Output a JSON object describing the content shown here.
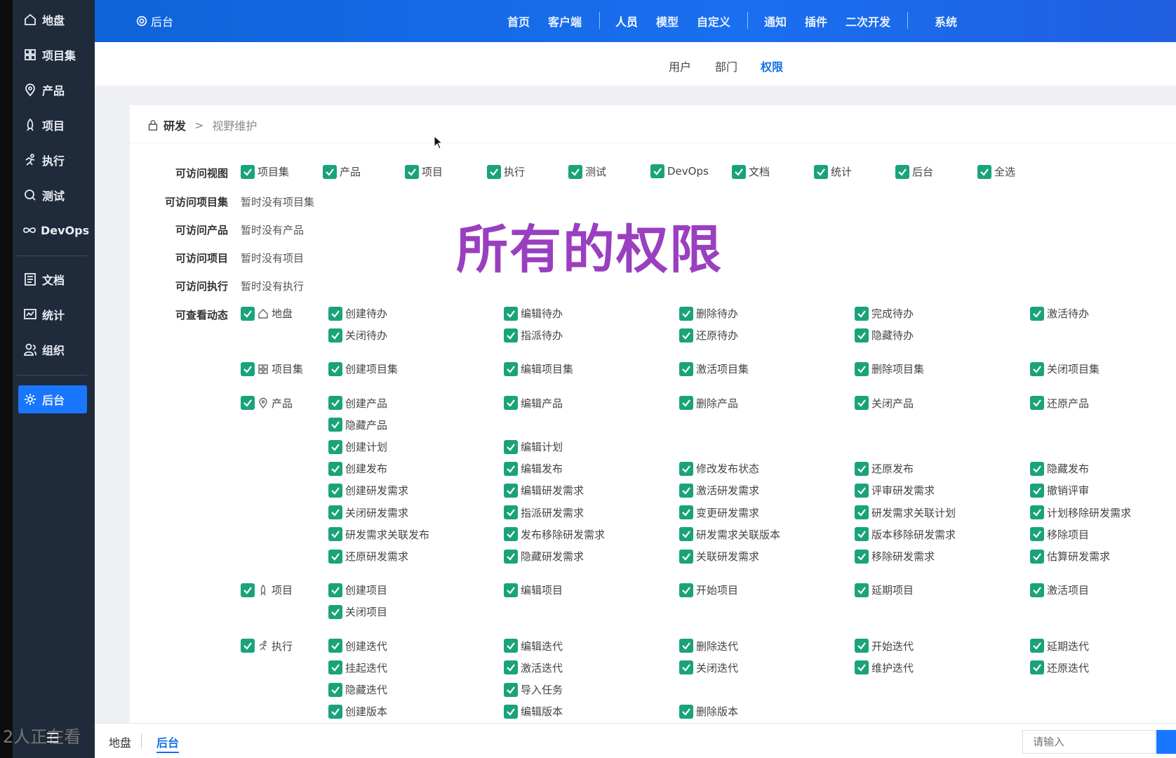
{
  "colors": {
    "sidebar_bg": "#1f2a3a",
    "header_blue": "#1a6ff0",
    "accent": "#1976ff",
    "check_green": "#1aa37a",
    "overlay_purple": "#9a3fbf"
  },
  "sidebar": {
    "items": [
      {
        "label": "地盘",
        "icon": "home-icon"
      },
      {
        "label": "项目集",
        "icon": "grid-icon"
      },
      {
        "label": "产品",
        "icon": "map-pin-icon"
      },
      {
        "label": "项目",
        "icon": "rocket-icon"
      },
      {
        "label": "执行",
        "icon": "runner-icon"
      },
      {
        "label": "测试",
        "icon": "magnifier-icon"
      },
      {
        "label": "DevOps",
        "icon": "infinity-icon"
      },
      {
        "label": "文档",
        "icon": "document-icon"
      },
      {
        "label": "统计",
        "icon": "chart-icon"
      },
      {
        "label": "组织",
        "icon": "people-icon"
      },
      {
        "label": "后台",
        "icon": "gear-icon",
        "active": true
      }
    ]
  },
  "header": {
    "brand": "后台",
    "nav": [
      "首页",
      "客户端",
      "人员",
      "模型",
      "自定义",
      "通知",
      "插件",
      "二次开发",
      "系统"
    ],
    "current": "人员"
  },
  "subnav": {
    "tabs": [
      "用户",
      "部门",
      "权限"
    ],
    "active": "权限"
  },
  "breadcrumb": {
    "root": "研发",
    "separator": ">",
    "current": "视野维护"
  },
  "overlay_text": "所有的权限",
  "form": {
    "views_label": "可访问视图",
    "views": [
      "项目集",
      "产品",
      "项目",
      "执行",
      "测试",
      "DevOps",
      "文档",
      "统计",
      "后台",
      "全选"
    ],
    "programs_label": "可访问项目集",
    "programs_value": "暂时没有项目集",
    "products_label": "可访问产品",
    "products_value": "暂时没有产品",
    "projects_label": "可访问项目",
    "projects_value": "暂时没有项目",
    "executions_label": "可访问执行",
    "executions_value": "暂时没有执行",
    "actions_label": "可查看动态",
    "groups": [
      {
        "module": "地盘",
        "icon": "home-icon",
        "rows": [
          [
            "创建待办",
            "编辑待办",
            "删除待办",
            "完成待办",
            "激活待办"
          ],
          [
            "关闭待办",
            "指派待办",
            "还原待办",
            "隐藏待办"
          ]
        ]
      },
      {
        "module": "项目集",
        "icon": "grid-icon",
        "rows": [
          [
            "创建项目集",
            "编辑项目集",
            "激活项目集",
            "删除项目集",
            "关闭项目集"
          ]
        ]
      },
      {
        "module": "产品",
        "icon": "map-pin-icon",
        "rows": [
          [
            "创建产品",
            "编辑产品",
            "删除产品",
            "关闭产品",
            "还原产品"
          ],
          [
            "隐藏产品"
          ],
          [
            "创建计划",
            "编辑计划"
          ],
          [
            "创建发布",
            "编辑发布",
            "修改发布状态",
            "还原发布",
            "隐藏发布"
          ],
          [
            "创建研发需求",
            "编辑研发需求",
            "激活研发需求",
            "评审研发需求",
            "撤销评审"
          ],
          [
            "关闭研发需求",
            "指派研发需求",
            "变更研发需求",
            "研发需求关联计划",
            "计划移除研发需求"
          ],
          [
            "研发需求关联发布",
            "发布移除研发需求",
            "研发需求关联版本",
            "版本移除研发需求",
            "移除项目"
          ],
          [
            "还原研发需求",
            "隐藏研发需求",
            "关联研发需求",
            "移除研发需求",
            "估算研发需求"
          ]
        ]
      },
      {
        "module": "项目",
        "icon": "rocket-icon",
        "rows": [
          [
            "创建项目",
            "编辑项目",
            "开始项目",
            "延期项目",
            "激活项目"
          ],
          [
            "关闭项目"
          ]
        ]
      },
      {
        "module": "执行",
        "icon": "runner-icon",
        "rows": [
          [
            "创建迭代",
            "编辑迭代",
            "删除迭代",
            "开始迭代",
            "延期迭代"
          ],
          [
            "挂起迭代",
            "激活迭代",
            "关闭迭代",
            "维护迭代",
            "还原迭代"
          ],
          [
            "隐藏迭代",
            "导入任务"
          ],
          [
            "创建版本",
            "编辑版本",
            "删除版本"
          ]
        ]
      }
    ]
  },
  "bottombar": {
    "tabs": [
      "地盘",
      "后台"
    ],
    "active": "后台",
    "search_placeholder": "请输入",
    "online_text": "2人正在看"
  }
}
